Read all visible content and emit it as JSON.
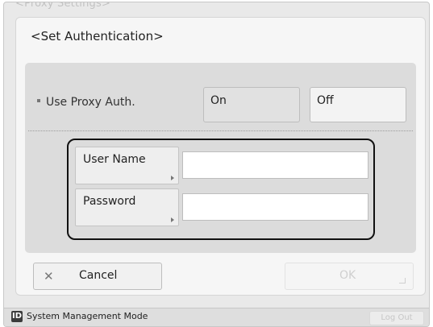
{
  "background_title": "<Proxy Settings>",
  "dialog": {
    "title": "<Set Authentication>"
  },
  "proxy_auth": {
    "label": "Use Proxy Auth.",
    "options": [
      "On",
      "Off"
    ],
    "selected": "On"
  },
  "fields": {
    "user_name": {
      "label": "User Name",
      "value": ""
    },
    "password": {
      "label": "Password",
      "value": ""
    }
  },
  "buttons": {
    "cancel": "Cancel",
    "ok": "OK"
  },
  "status_bar": {
    "mode_icon_letter": "ID",
    "mode_text": "System Management Mode",
    "logout": "Log Out"
  },
  "colors": {
    "selected_toggle": "#e1e1e1",
    "highlight_border": "#111111",
    "disabled_text": "#cfcfcf"
  }
}
